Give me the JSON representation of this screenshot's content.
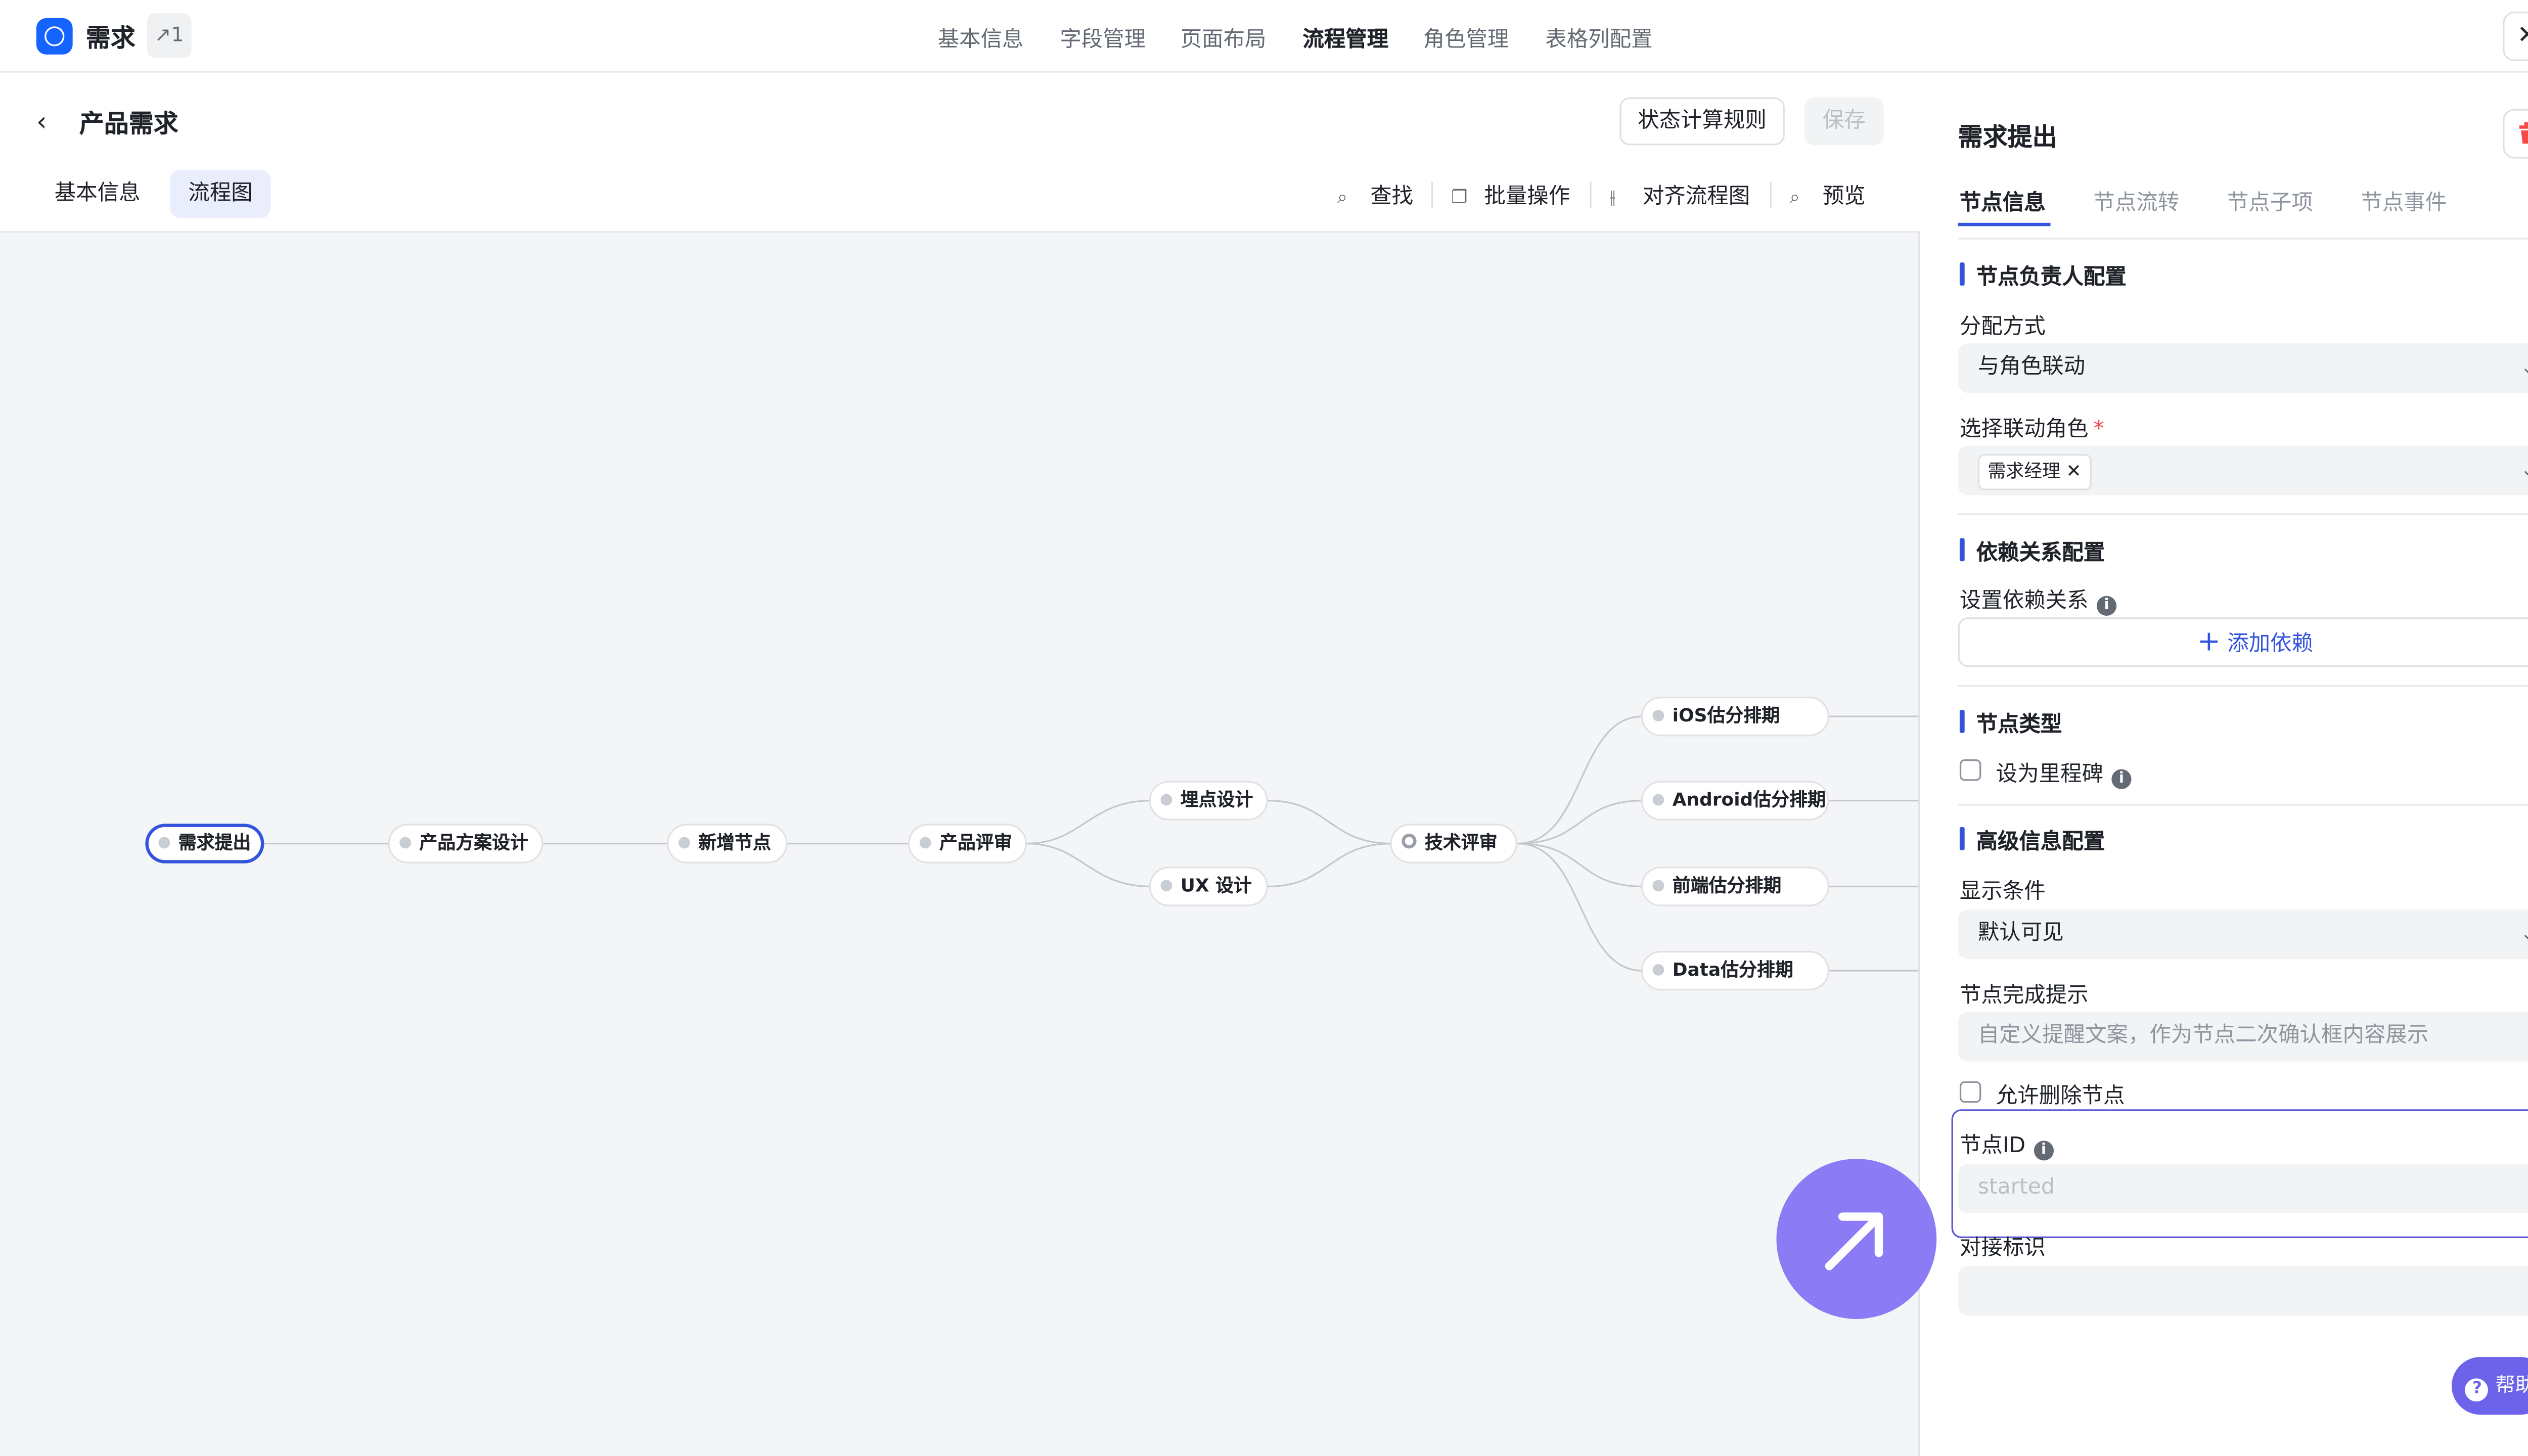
{
  "app": {
    "title": "需求",
    "share_count": "1"
  },
  "top_tabs": [
    {
      "label": "基本信息"
    },
    {
      "label": "字段管理"
    },
    {
      "label": "页面布局"
    },
    {
      "label": "流程管理",
      "active": true
    },
    {
      "label": "角色管理"
    },
    {
      "label": "表格列配置"
    }
  ],
  "header": {
    "page_title": "产品需求",
    "rules_button": "状态计算规则",
    "save_button": "保存"
  },
  "sub_tabs": [
    {
      "label": "基本信息"
    },
    {
      "label": "流程图",
      "active": true
    }
  ],
  "toolbar": {
    "find": "查找",
    "batch": "批量操作",
    "align": "对齐流程图",
    "preview": "预览"
  },
  "flow_nodes": {
    "n1": "需求提出",
    "n2": "产品方案设计",
    "n3": "新增节点",
    "n4": "产品评审",
    "n5": "埋点设计",
    "n6": "UX 设计",
    "n7": "技术评审",
    "n8": "iOS估分排期",
    "n9": "Android估分排期",
    "n10": "前端估分排期",
    "n11": "Data估分排期"
  },
  "panel": {
    "title": "需求提出",
    "tabs": [
      {
        "label": "节点信息",
        "active": true
      },
      {
        "label": "节点流转"
      },
      {
        "label": "节点子项"
      },
      {
        "label": "节点事件"
      }
    ],
    "owner_section": "节点负责人配置",
    "assign_label": "分配方式",
    "assign_value": "与角色联动",
    "role_label": "选择联动角色",
    "role_tag": "需求经理",
    "dep_section": "依赖关系配置",
    "dep_label": "设置依赖关系",
    "add_dep": "添加依赖",
    "type_section": "节点类型",
    "milestone_label": "设为里程碑",
    "adv_section": "高级信息配置",
    "display_label": "显示条件",
    "display_value": "默认可见",
    "tip_label": "节点完成提示",
    "tip_placeholder": "自定义提醒文案，作为节点二次确认框内容展示",
    "allow_delete_label": "允许删除节点",
    "node_id_label": "节点ID",
    "node_id_placeholder": "started",
    "integration_label": "对接标识"
  },
  "help": {
    "label": "帮助"
  },
  "colors": {
    "accent": "#3355dd",
    "brand": "#1664ff",
    "fab": "#8b7cf6",
    "help": "#6c63ea",
    "danger": "#f54a45"
  }
}
